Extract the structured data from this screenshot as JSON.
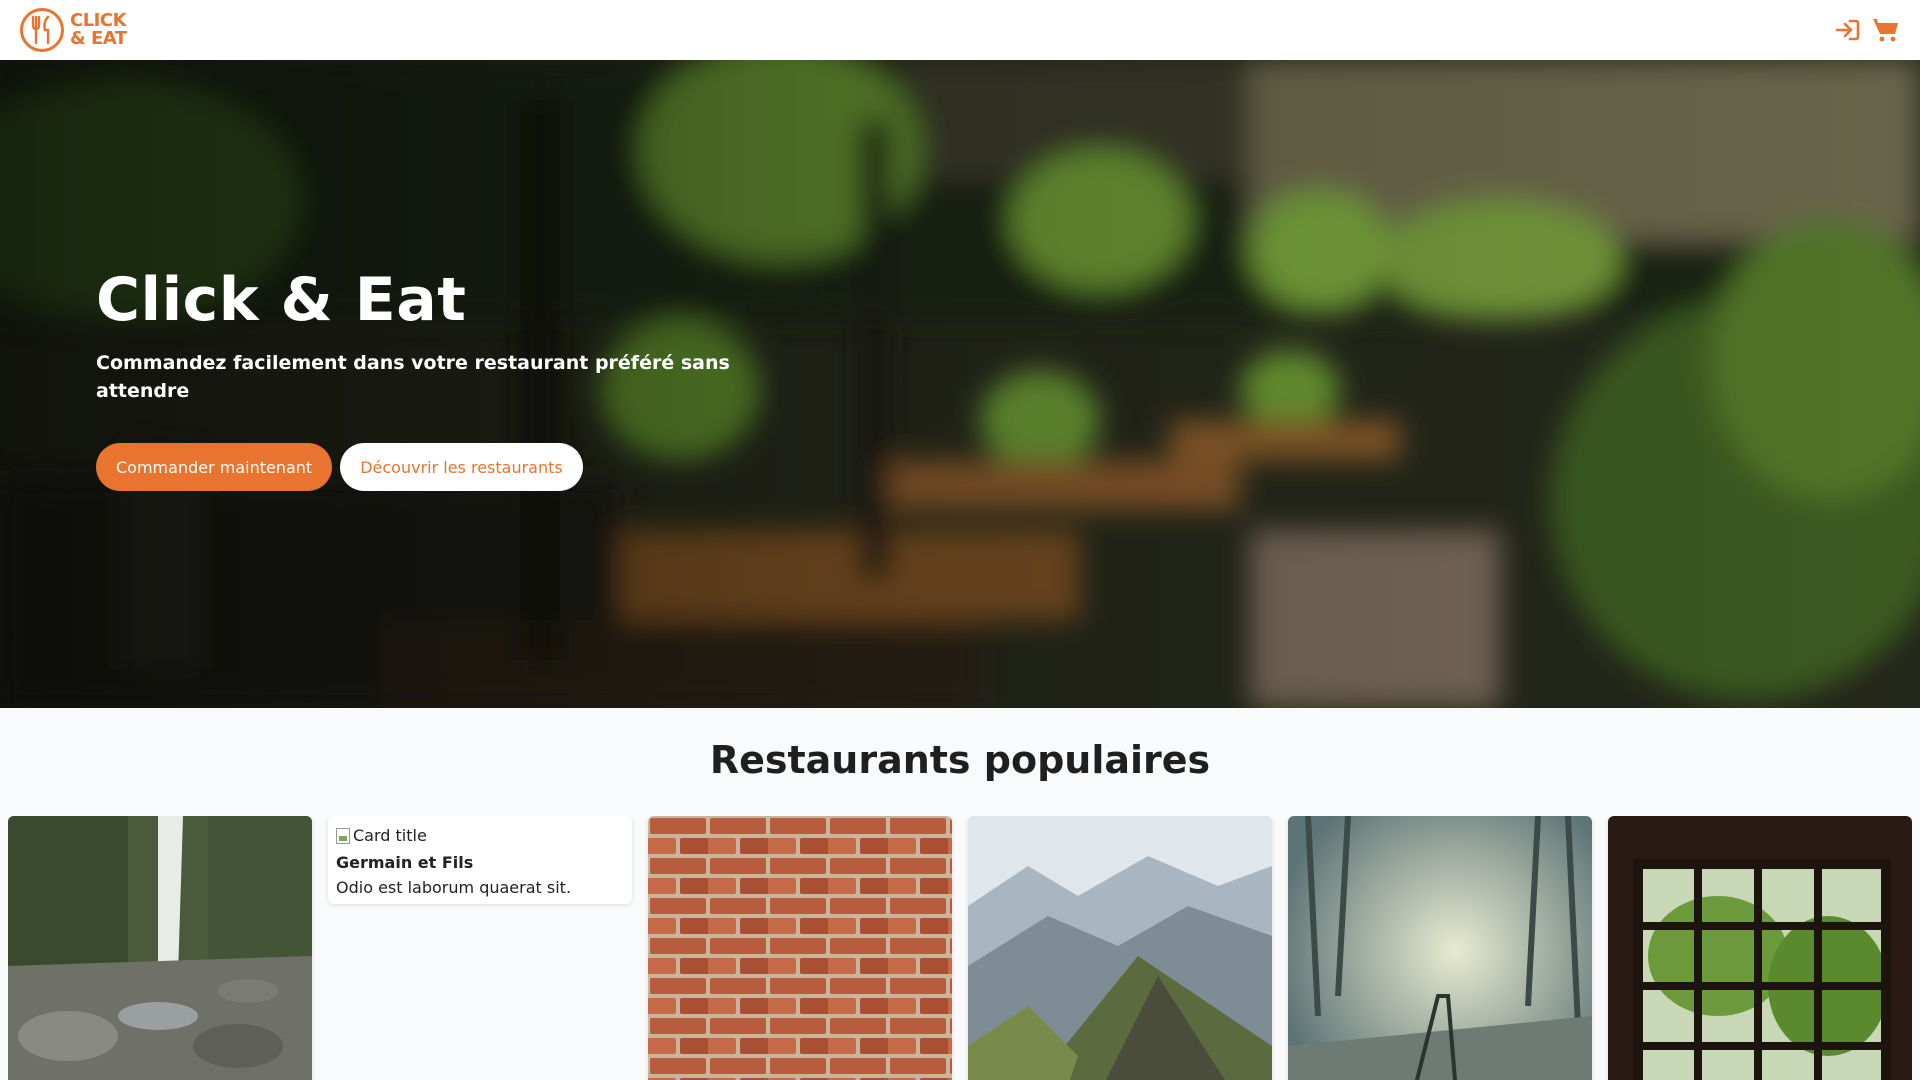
{
  "header": {
    "logo_line1": "CLICK",
    "logo_line2": "& EAT",
    "login_icon": "sign-in-icon",
    "cart_icon": "shopping-cart-icon",
    "accent_color": "#e8742f"
  },
  "hero": {
    "title": "Click & Eat",
    "subtitle": "Commandez facilement dans votre restaurant préféré sans attendre",
    "primary_button": "Commander maintenant",
    "secondary_button": "Découvrir les restaurants"
  },
  "restaurants": {
    "section_title": "Restaurants populaires",
    "cards": [
      {
        "image": "waterfall-photo"
      },
      {
        "image_alt": "Card title",
        "name": "Germain et Fils",
        "description": "Odio est laborum quaerat sit."
      },
      {
        "image": "brick-wall-photo"
      },
      {
        "image": "mountains-photo"
      },
      {
        "image": "foggy-railway-photo"
      },
      {
        "image": "window-forest-photo"
      }
    ]
  }
}
